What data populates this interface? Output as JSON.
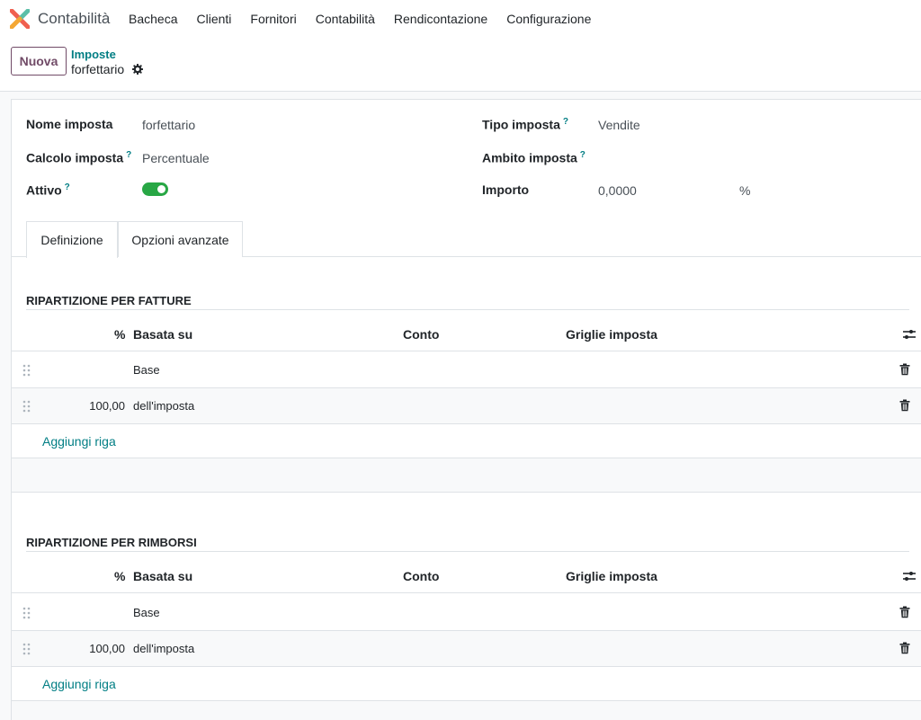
{
  "app": {
    "name": "Contabilità"
  },
  "menu": [
    "Bacheca",
    "Clienti",
    "Fornitori",
    "Contabilità",
    "Rendicontazione",
    "Configurazione"
  ],
  "control": {
    "new_label": "Nuova",
    "breadcrumb_parent": "Imposte",
    "breadcrumb_current": "forfettario"
  },
  "form": {
    "name_label": "Nome imposta",
    "name_value": "forfettario",
    "calc_label": "Calcolo imposta",
    "calc_value": "Percentuale",
    "active_label": "Attivo",
    "active_value": true,
    "type_label": "Tipo imposta",
    "type_value": "Vendite",
    "scope_label": "Ambito imposta",
    "scope_value": "",
    "amount_label": "Importo",
    "amount_value": "0,0000",
    "amount_unit": "%",
    "help_mark": "?"
  },
  "tabs": [
    "Definizione",
    "Opzioni avanzate"
  ],
  "invoices": {
    "title": "RIPARTIZIONE PER FATTURE",
    "headers": [
      "%",
      "Basata su",
      "Conto",
      "Griglie imposta"
    ],
    "rows": [
      {
        "pct": "",
        "based_on": "Base"
      },
      {
        "pct": "100,00",
        "based_on": "dell'imposta"
      }
    ],
    "add_line": "Aggiungi riga"
  },
  "refunds": {
    "title": "RIPARTIZIONE PER RIMBORSI",
    "headers": [
      "%",
      "Basata su",
      "Conto",
      "Griglie imposta"
    ],
    "rows": [
      {
        "pct": "",
        "based_on": "Base"
      },
      {
        "pct": "100,00",
        "based_on": "dell'imposta"
      }
    ],
    "add_line": "Aggiungi riga"
  },
  "colors": {
    "accent": "#017e84",
    "brand": "#714b67",
    "toggle_on": "#28a745"
  }
}
